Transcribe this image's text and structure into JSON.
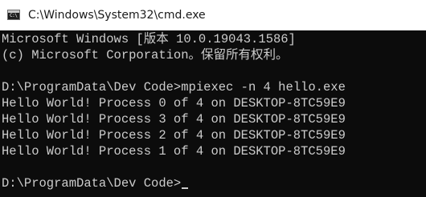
{
  "window": {
    "title": "C:\\Windows\\System32\\cmd.exe",
    "icon": "cmd-icon"
  },
  "console": {
    "lines": [
      "Microsoft Windows [版本 10.0.19043.1586]",
      "(c) Microsoft Corporation。保留所有权利。",
      "",
      "D:\\ProgramData\\Dev Code>mpiexec -n 4 hello.exe",
      "Hello World! Process 0 of 4 on DESKTOP-8TC59E9",
      "Hello World! Process 3 of 4 on DESKTOP-8TC59E9",
      "Hello World! Process 2 of 4 on DESKTOP-8TC59E9",
      "Hello World! Process 1 of 4 on DESKTOP-8TC59E9",
      "",
      "D:\\ProgramData\\Dev Code>"
    ]
  },
  "colors": {
    "background": "#0c0c0c",
    "text": "#cccccc",
    "titlebar": "#ffffff"
  }
}
